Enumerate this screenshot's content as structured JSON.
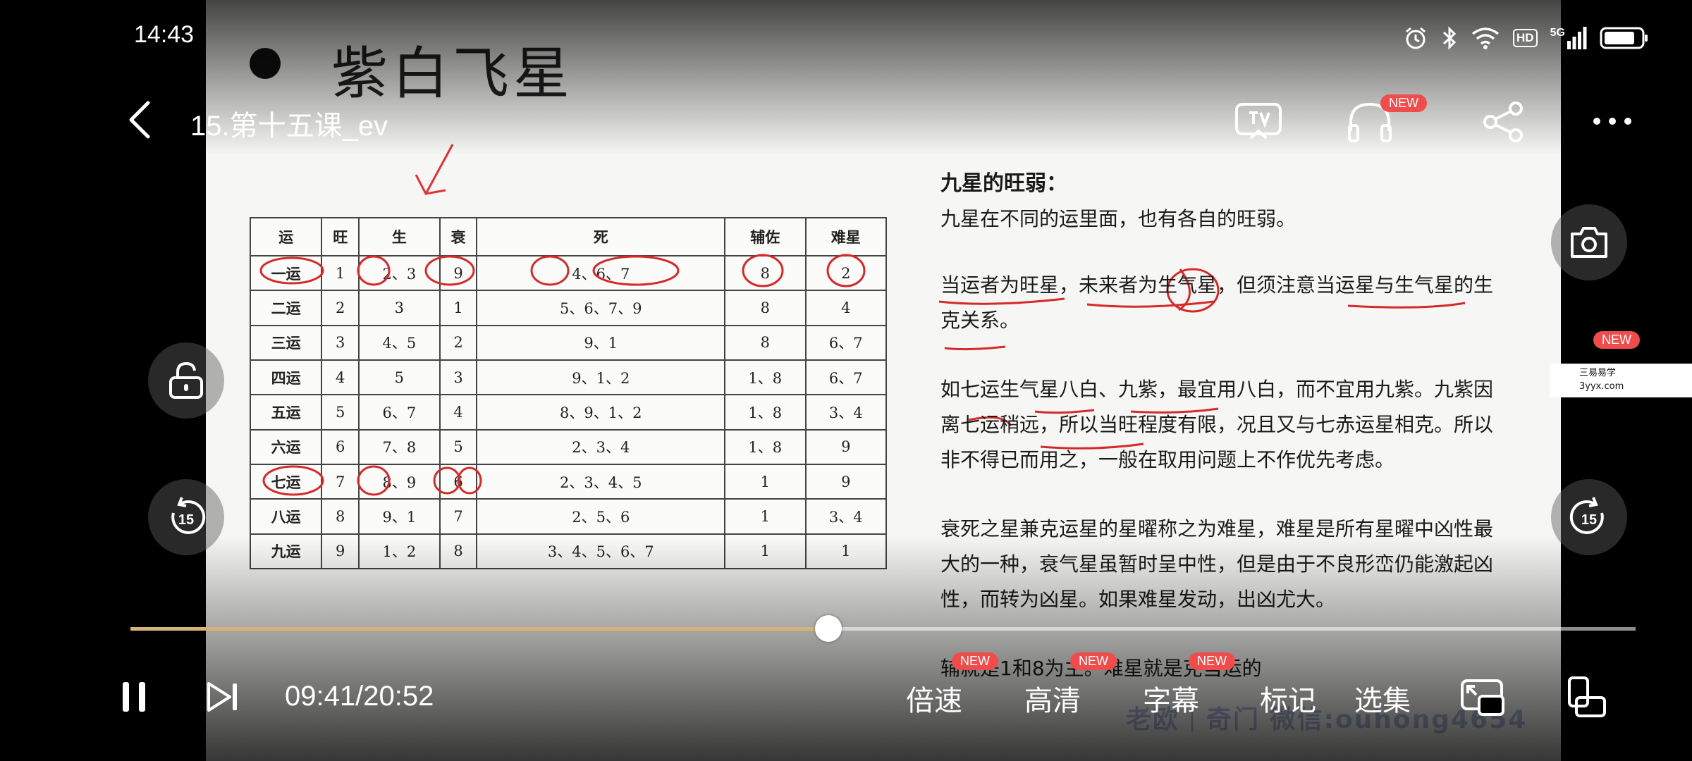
{
  "status_bar": {
    "time": "14:43",
    "network": "5G",
    "hd": "HD"
  },
  "player": {
    "title": "15.第十五课_ev",
    "current_time": "09:41",
    "duration": "20:52",
    "time_display": "09:41/20:52",
    "progress_fraction": 0.4637,
    "accent_color": "#d6b27a",
    "badge_color": "#f04c4c"
  },
  "badges": {
    "new": "NEW"
  },
  "menu": {
    "speed": "倍速",
    "quality": "高清",
    "subtitles": "字幕",
    "bookmark": "标记",
    "episodes": "选集"
  },
  "side_logo": {
    "line1": "三易易学",
    "line2": "3yyx.com"
  },
  "slide": {
    "title": "紫白飞星",
    "table": {
      "headers": [
        "运",
        "旺",
        "生",
        "衰",
        "死",
        "辅佐",
        "难星"
      ],
      "rows": [
        [
          "一运",
          "1",
          "2、3",
          "9",
          "4、6、7",
          "8",
          "2"
        ],
        [
          "二运",
          "2",
          "3",
          "1",
          "5、6、7、9",
          "8",
          "4"
        ],
        [
          "三运",
          "3",
          "4、5",
          "2",
          "9、1",
          "8",
          "6、7"
        ],
        [
          "四运",
          "4",
          "5",
          "3",
          "9、1、2",
          "1、8",
          "6、7"
        ],
        [
          "五运",
          "5",
          "6、7",
          "4",
          "8、9、1、2",
          "1、8",
          "3、4"
        ],
        [
          "六运",
          "6",
          "7、8",
          "5",
          "2、3、4",
          "1、8",
          "9"
        ],
        [
          "七运",
          "7",
          "8、9",
          "6",
          "2、3、4、5",
          "1",
          "9"
        ],
        [
          "八运",
          "8",
          "9、1",
          "7",
          "2、5、6",
          "1",
          "3、4"
        ],
        [
          "九运",
          "9",
          "1、2",
          "8",
          "3、4、5、6、7",
          "1",
          "1"
        ]
      ]
    },
    "notes": {
      "heading": "九星的旺弱：",
      "p1": "九星在不同的运里面，也有各自的旺弱。",
      "p2": "当运者为旺星，未来者为生气星，但须注意当运星与生气星的生克关系。",
      "p3": "如七运生气星八白、九紫，最宜用八白，而不宜用九紫。九紫因离七运稍远，所以当旺程度有限，况且又与七赤运星相克。所以非不得已而用之，一般在取用问题上不作优先考虑。",
      "p4": "衰死之星兼克运星的星曜称之为难星，难星是所有星曜中凶性最大的一种，衰气星虽暂时呈中性，但是由于不良形峦仍能激起凶性，而转为凶星。如果难星发动，出凶尤大。",
      "p5": "辅就是1和8为主。难星就是克当运的"
    },
    "watermark": "老欧｜奇门 微信:ouhong4654"
  }
}
